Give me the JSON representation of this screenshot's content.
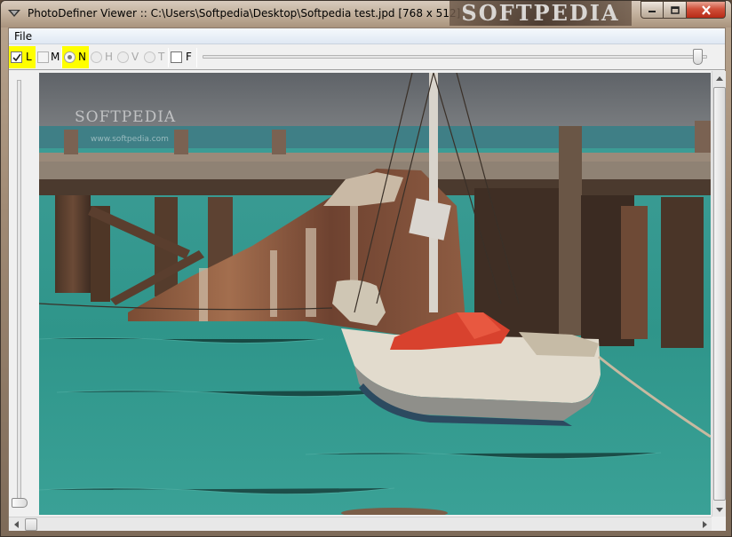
{
  "window": {
    "title": "PhotoDefiner Viewer :: C:\\Users\\Softpedia\\Desktop\\Softpedia test.jpd [768 x 512]",
    "watermark": "SOFTPEDIA",
    "controls": {
      "minimize_icon": "minimize-icon",
      "maximize_icon": "maximize-icon",
      "close_icon": "close-icon"
    }
  },
  "menu": {
    "items": [
      {
        "label": "File"
      }
    ]
  },
  "toolbar": {
    "options": [
      {
        "label": "L",
        "kind": "checkbox",
        "checked": true,
        "highlighted": true,
        "enabled": true
      },
      {
        "label": "M",
        "kind": "checkbox",
        "checked": false,
        "highlighted": false,
        "enabled": false
      },
      {
        "label": "N",
        "kind": "radio",
        "checked": true,
        "highlighted": true,
        "enabled": true
      },
      {
        "label": "H",
        "kind": "radio",
        "checked": false,
        "highlighted": false,
        "enabled": false
      },
      {
        "label": "V",
        "kind": "radio",
        "checked": false,
        "highlighted": false,
        "enabled": false
      },
      {
        "label": "T",
        "kind": "radio",
        "checked": false,
        "highlighted": false,
        "enabled": false
      },
      {
        "label": "F",
        "kind": "checkbox",
        "checked": false,
        "highlighted": false,
        "enabled": true
      }
    ],
    "zoom_slider_value": 1.0
  },
  "left_slider_value": 0.0,
  "image": {
    "description_icon": "photo-image"
  },
  "overlay": {
    "watermark": "SOFTPEDIA",
    "url": "www.softpedia.com"
  },
  "colors": {
    "highlight": "#ffff00",
    "sea": "#2f9a8e",
    "sky": "#6b6f74"
  }
}
